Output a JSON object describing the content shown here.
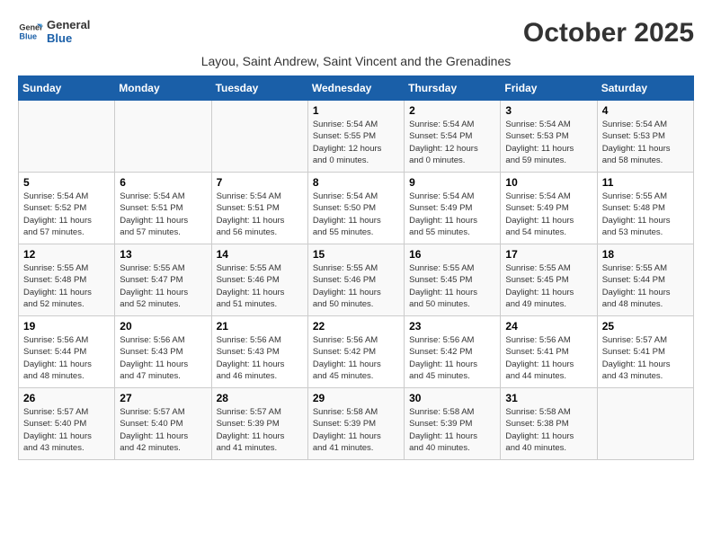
{
  "header": {
    "logo_line1": "General",
    "logo_line2": "Blue",
    "month": "October 2025",
    "location": "Layou, Saint Andrew, Saint Vincent and the Grenadines"
  },
  "days_of_week": [
    "Sunday",
    "Monday",
    "Tuesday",
    "Wednesday",
    "Thursday",
    "Friday",
    "Saturday"
  ],
  "weeks": [
    [
      {
        "day": "",
        "info": ""
      },
      {
        "day": "",
        "info": ""
      },
      {
        "day": "",
        "info": ""
      },
      {
        "day": "1",
        "info": "Sunrise: 5:54 AM\nSunset: 5:55 PM\nDaylight: 12 hours\nand 0 minutes."
      },
      {
        "day": "2",
        "info": "Sunrise: 5:54 AM\nSunset: 5:54 PM\nDaylight: 12 hours\nand 0 minutes."
      },
      {
        "day": "3",
        "info": "Sunrise: 5:54 AM\nSunset: 5:53 PM\nDaylight: 11 hours\nand 59 minutes."
      },
      {
        "day": "4",
        "info": "Sunrise: 5:54 AM\nSunset: 5:53 PM\nDaylight: 11 hours\nand 58 minutes."
      }
    ],
    [
      {
        "day": "5",
        "info": "Sunrise: 5:54 AM\nSunset: 5:52 PM\nDaylight: 11 hours\nand 57 minutes."
      },
      {
        "day": "6",
        "info": "Sunrise: 5:54 AM\nSunset: 5:51 PM\nDaylight: 11 hours\nand 57 minutes."
      },
      {
        "day": "7",
        "info": "Sunrise: 5:54 AM\nSunset: 5:51 PM\nDaylight: 11 hours\nand 56 minutes."
      },
      {
        "day": "8",
        "info": "Sunrise: 5:54 AM\nSunset: 5:50 PM\nDaylight: 11 hours\nand 55 minutes."
      },
      {
        "day": "9",
        "info": "Sunrise: 5:54 AM\nSunset: 5:49 PM\nDaylight: 11 hours\nand 55 minutes."
      },
      {
        "day": "10",
        "info": "Sunrise: 5:54 AM\nSunset: 5:49 PM\nDaylight: 11 hours\nand 54 minutes."
      },
      {
        "day": "11",
        "info": "Sunrise: 5:55 AM\nSunset: 5:48 PM\nDaylight: 11 hours\nand 53 minutes."
      }
    ],
    [
      {
        "day": "12",
        "info": "Sunrise: 5:55 AM\nSunset: 5:48 PM\nDaylight: 11 hours\nand 52 minutes."
      },
      {
        "day": "13",
        "info": "Sunrise: 5:55 AM\nSunset: 5:47 PM\nDaylight: 11 hours\nand 52 minutes."
      },
      {
        "day": "14",
        "info": "Sunrise: 5:55 AM\nSunset: 5:46 PM\nDaylight: 11 hours\nand 51 minutes."
      },
      {
        "day": "15",
        "info": "Sunrise: 5:55 AM\nSunset: 5:46 PM\nDaylight: 11 hours\nand 50 minutes."
      },
      {
        "day": "16",
        "info": "Sunrise: 5:55 AM\nSunset: 5:45 PM\nDaylight: 11 hours\nand 50 minutes."
      },
      {
        "day": "17",
        "info": "Sunrise: 5:55 AM\nSunset: 5:45 PM\nDaylight: 11 hours\nand 49 minutes."
      },
      {
        "day": "18",
        "info": "Sunrise: 5:55 AM\nSunset: 5:44 PM\nDaylight: 11 hours\nand 48 minutes."
      }
    ],
    [
      {
        "day": "19",
        "info": "Sunrise: 5:56 AM\nSunset: 5:44 PM\nDaylight: 11 hours\nand 48 minutes."
      },
      {
        "day": "20",
        "info": "Sunrise: 5:56 AM\nSunset: 5:43 PM\nDaylight: 11 hours\nand 47 minutes."
      },
      {
        "day": "21",
        "info": "Sunrise: 5:56 AM\nSunset: 5:43 PM\nDaylight: 11 hours\nand 46 minutes."
      },
      {
        "day": "22",
        "info": "Sunrise: 5:56 AM\nSunset: 5:42 PM\nDaylight: 11 hours\nand 45 minutes."
      },
      {
        "day": "23",
        "info": "Sunrise: 5:56 AM\nSunset: 5:42 PM\nDaylight: 11 hours\nand 45 minutes."
      },
      {
        "day": "24",
        "info": "Sunrise: 5:56 AM\nSunset: 5:41 PM\nDaylight: 11 hours\nand 44 minutes."
      },
      {
        "day": "25",
        "info": "Sunrise: 5:57 AM\nSunset: 5:41 PM\nDaylight: 11 hours\nand 43 minutes."
      }
    ],
    [
      {
        "day": "26",
        "info": "Sunrise: 5:57 AM\nSunset: 5:40 PM\nDaylight: 11 hours\nand 43 minutes."
      },
      {
        "day": "27",
        "info": "Sunrise: 5:57 AM\nSunset: 5:40 PM\nDaylight: 11 hours\nand 42 minutes."
      },
      {
        "day": "28",
        "info": "Sunrise: 5:57 AM\nSunset: 5:39 PM\nDaylight: 11 hours\nand 41 minutes."
      },
      {
        "day": "29",
        "info": "Sunrise: 5:58 AM\nSunset: 5:39 PM\nDaylight: 11 hours\nand 41 minutes."
      },
      {
        "day": "30",
        "info": "Sunrise: 5:58 AM\nSunset: 5:39 PM\nDaylight: 11 hours\nand 40 minutes."
      },
      {
        "day": "31",
        "info": "Sunrise: 5:58 AM\nSunset: 5:38 PM\nDaylight: 11 hours\nand 40 minutes."
      },
      {
        "day": "",
        "info": ""
      }
    ]
  ]
}
